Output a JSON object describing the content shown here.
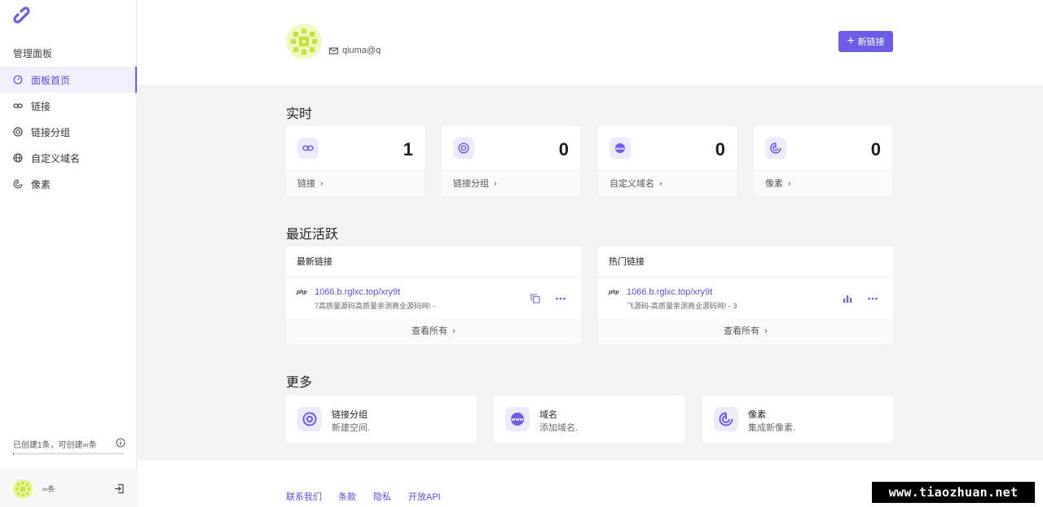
{
  "sidebar": {
    "section_title": "管理面板",
    "items": [
      {
        "label": "面板首页",
        "icon": "dashboard-icon",
        "active": true
      },
      {
        "label": "链接",
        "icon": "link-icon",
        "active": false
      },
      {
        "label": "链接分组",
        "icon": "target-icon",
        "active": false
      },
      {
        "label": "自定义域名",
        "icon": "globe-icon",
        "active": false
      },
      {
        "label": "像素",
        "icon": "pixel-icon",
        "active": false
      }
    ],
    "usage_text": "已创建1条，可创建∞条",
    "usage_fraction": 0.01,
    "user_name": "∞条",
    "accent": "#6c5ce7"
  },
  "header": {
    "email": "qiuma@q",
    "new_button": "新链接"
  },
  "realtime": {
    "title": "实时",
    "stats": [
      {
        "value": "1",
        "label": "链接",
        "icon": "link-icon"
      },
      {
        "value": "0",
        "label": "链接分组",
        "icon": "target-icon"
      },
      {
        "value": "0",
        "label": "自定义域名",
        "icon": "www-icon"
      },
      {
        "value": "0",
        "label": "像素",
        "icon": "pixel-icon"
      }
    ]
  },
  "recent": {
    "title": "最近活跃",
    "latest": {
      "title": "最新链接",
      "badge": "php",
      "url": "1066.b.rglxc.top/xry9t",
      "desc": "7高质量源码高质量亲测商业源码网! -",
      "view_all": "查看所有"
    },
    "popular": {
      "title": "热门链接",
      "badge": "php",
      "url": "1066.b.rglxc.top/xry9t",
      "desc": "飞源码-高质量亲测商业源码网! - 3",
      "view_all": "查看所有"
    }
  },
  "more": {
    "title": "更多",
    "cards": [
      {
        "title": "链接分组",
        "subtitle": "新建空间.",
        "icon": "target-icon"
      },
      {
        "title": "域名",
        "subtitle": "添加域名.",
        "icon": "www-icon"
      },
      {
        "title": "像素",
        "subtitle": "集成新像素.",
        "icon": "pixel-icon"
      }
    ]
  },
  "footer": {
    "links": [
      "联系我们",
      "条款",
      "隐私",
      "开放API"
    ]
  },
  "watermark": "www.tiaozhuan.net"
}
